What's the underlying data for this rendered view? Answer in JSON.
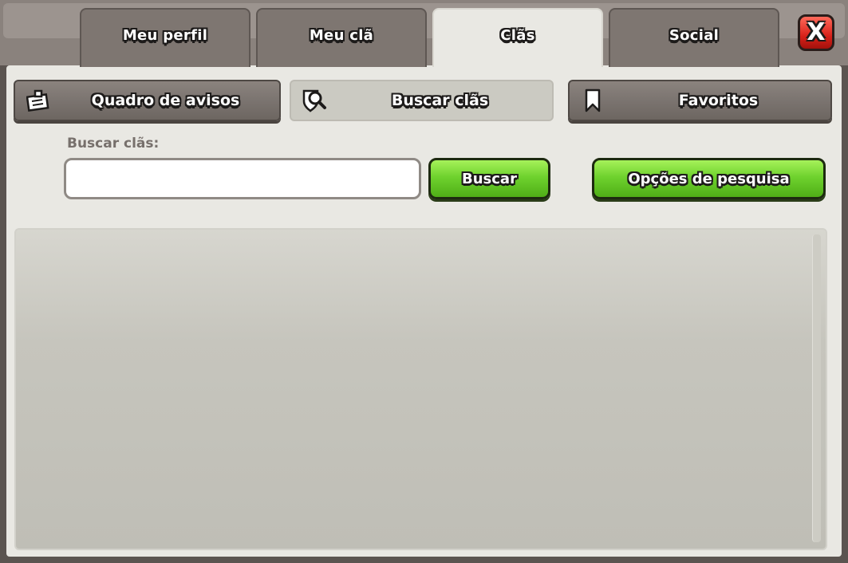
{
  "tabs": [
    {
      "label": "Meu perfil"
    },
    {
      "label": "Meu clã"
    },
    {
      "label": "Clãs"
    },
    {
      "label": "Social"
    }
  ],
  "close_label": "X",
  "subtabs": [
    {
      "label": "Quadro de avisos",
      "icon": "notice-board-icon"
    },
    {
      "label": "Buscar clãs",
      "icon": "search-clan-icon"
    },
    {
      "label": "Favoritos",
      "icon": "bookmark-icon"
    }
  ],
  "search": {
    "label": "Buscar clãs:",
    "value": "",
    "button_label": "Buscar",
    "options_label": "Opções de pesquisa"
  },
  "colors": {
    "accent_green": "#6fd22e",
    "close_red": "#d8211a",
    "panel": "#e9e8e3"
  }
}
